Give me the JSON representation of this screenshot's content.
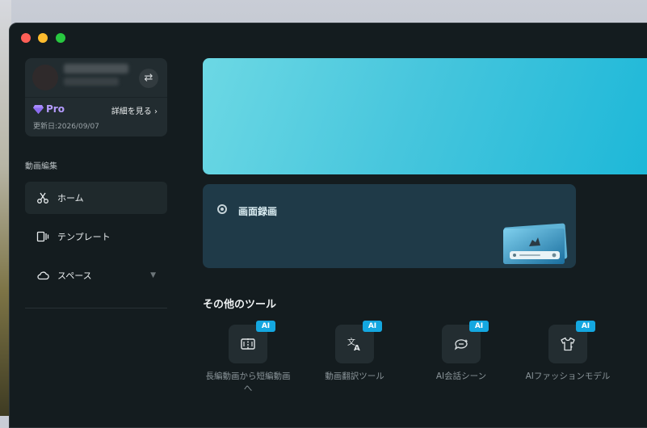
{
  "account": {
    "switch_icon": "swap-icon",
    "plan": "Pro",
    "details_link": "詳細を見る ›",
    "updated": "更新日:2026/09/07"
  },
  "sidebar": {
    "section_label": "動画編集",
    "items": [
      {
        "label": "ホーム",
        "icon": "scissors-icon",
        "active": true
      },
      {
        "label": "テンプレート",
        "icon": "template-icon",
        "active": false
      },
      {
        "label": "スペース",
        "icon": "cloud-icon",
        "active": false
      }
    ]
  },
  "record": {
    "label": "画面録画"
  },
  "tools": {
    "title": "その他のツール",
    "items": [
      {
        "label": "長編動画から短編動画へ",
        "badge": "AI",
        "icon": "film-cut-icon"
      },
      {
        "label": "動画翻訳ツール",
        "badge": "AI",
        "icon": "translate-icon"
      },
      {
        "label": "AI会話シーン",
        "badge": "AI",
        "icon": "chat-sparkle-icon"
      },
      {
        "label": "AIファッションモデル",
        "badge": "AI",
        "icon": "tshirt-icon"
      }
    ]
  },
  "colors": {
    "background": "#141c1f",
    "accent": "#14a7e0",
    "pro": "#b69cff",
    "banner": "#47c6dd"
  }
}
